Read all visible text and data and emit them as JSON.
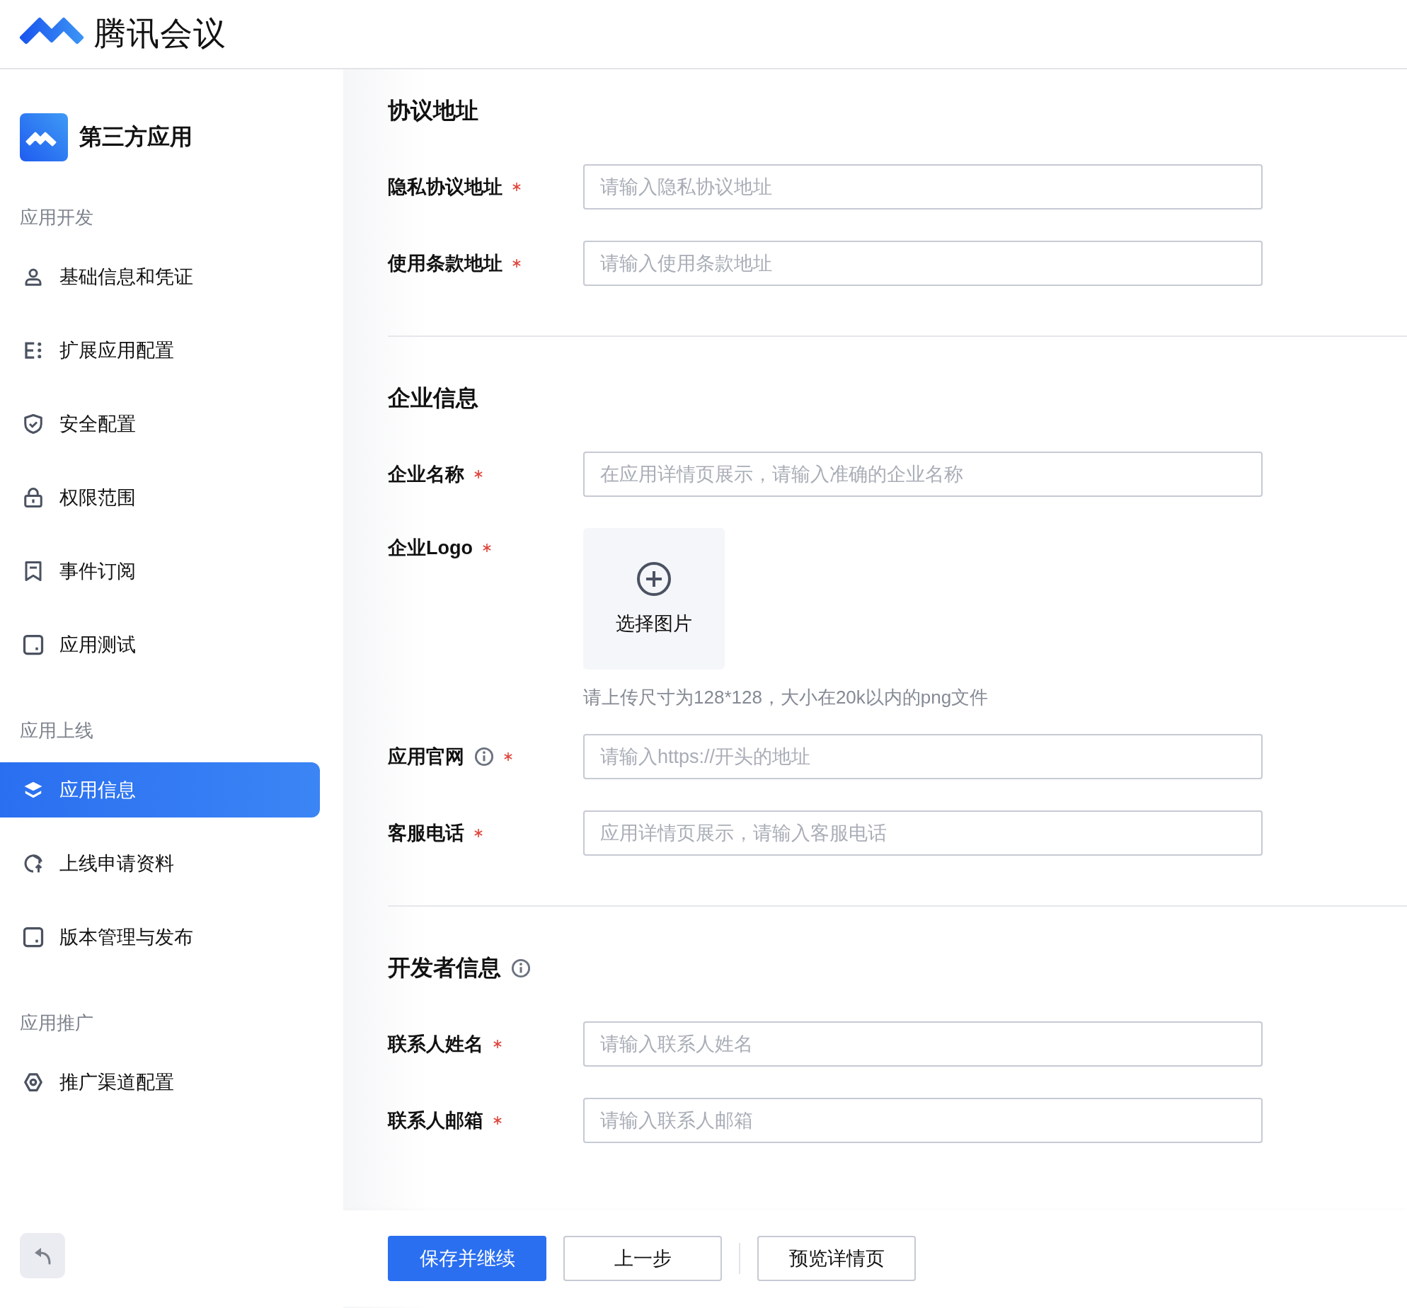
{
  "header": {
    "product_name": "腾讯会议"
  },
  "sidebar": {
    "app_title": "第三方应用",
    "groups": [
      {
        "title": "应用开发",
        "items": [
          {
            "label": "基础信息和凭证",
            "kind": "person",
            "selected": false
          },
          {
            "label": "扩展应用配置",
            "kind": "list",
            "selected": false
          },
          {
            "label": "安全配置",
            "kind": "shield",
            "selected": false
          },
          {
            "label": "权限范围",
            "kind": "lock",
            "selected": false
          },
          {
            "label": "事件订阅",
            "kind": "bookmark",
            "selected": false
          },
          {
            "label": "应用测试",
            "kind": "square",
            "selected": false
          }
        ]
      },
      {
        "title": "应用上线",
        "items": [
          {
            "label": "应用信息",
            "kind": "layers",
            "selected": true
          },
          {
            "label": "上线申请资料",
            "kind": "upload",
            "selected": false
          },
          {
            "label": "版本管理与发布",
            "kind": "square",
            "selected": false
          }
        ]
      },
      {
        "title": "应用推广",
        "items": [
          {
            "label": "推广渠道配置",
            "kind": "gear",
            "selected": false
          }
        ]
      }
    ]
  },
  "sections": [
    {
      "title": "协议地址",
      "info": false,
      "fields": [
        {
          "kind": "input",
          "label": "隐私协议地址",
          "required": true,
          "info": false,
          "placeholder": "请输入隐私协议地址"
        },
        {
          "kind": "input",
          "label": "使用条款地址",
          "required": true,
          "info": false,
          "placeholder": "请输入使用条款地址"
        }
      ]
    },
    {
      "title": "企业信息",
      "info": false,
      "fields": [
        {
          "kind": "input",
          "label": "企业名称",
          "required": true,
          "info": false,
          "placeholder": "在应用详情页展示，请输入准确的企业名称"
        },
        {
          "kind": "upload",
          "label": "企业Logo",
          "required": true,
          "info": false,
          "button": "选择图片",
          "hint": "请上传尺寸为128*128，大小在20k以内的png文件"
        },
        {
          "kind": "input",
          "label": "应用官网",
          "required": true,
          "info": true,
          "placeholder": "请输入https://开头的地址"
        },
        {
          "kind": "input",
          "label": "客服电话",
          "required": true,
          "info": false,
          "placeholder": "应用详情页展示，请输入客服电话"
        }
      ]
    },
    {
      "title": "开发者信息",
      "info": true,
      "fields": [
        {
          "kind": "input",
          "label": "联系人姓名",
          "required": true,
          "info": false,
          "placeholder": "请输入联系人姓名"
        },
        {
          "kind": "input",
          "label": "联系人邮箱",
          "required": true,
          "info": false,
          "placeholder": "请输入联系人邮箱"
        }
      ]
    }
  ],
  "footer": {
    "buttons": [
      {
        "kind": "primary",
        "label": "保存并继续"
      },
      {
        "kind": "secondary",
        "label": "上一步"
      },
      {
        "kind": "separator"
      },
      {
        "kind": "secondary",
        "label": "预览详情页"
      }
    ]
  }
}
